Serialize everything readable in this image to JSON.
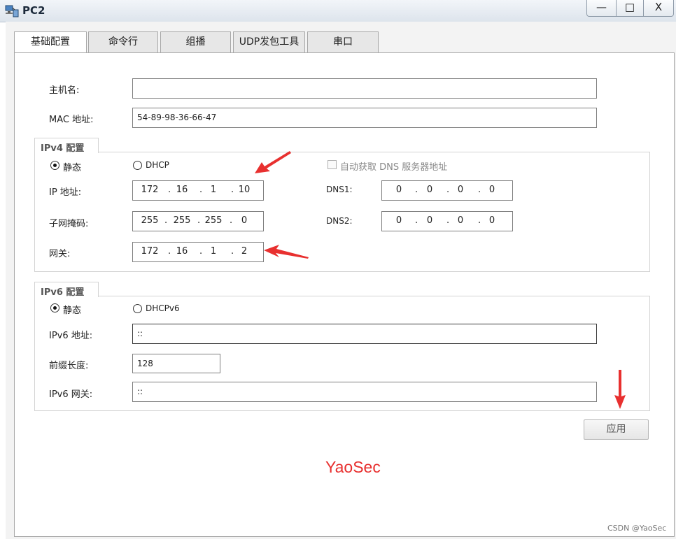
{
  "window": {
    "title": "PC2",
    "controls": {
      "minimize": "—",
      "maximize": "□",
      "close": "X"
    }
  },
  "tabs": [
    {
      "label": "基础配置",
      "active": true
    },
    {
      "label": "命令行",
      "active": false
    },
    {
      "label": "组播",
      "active": false
    },
    {
      "label": "UDP发包工具",
      "active": false
    },
    {
      "label": "串口",
      "active": false
    }
  ],
  "basic": {
    "hostname_label": "主机名:",
    "hostname_value": "",
    "mac_label": "MAC 地址:",
    "mac_value": "54-89-98-36-66-47"
  },
  "ipv4": {
    "group_title": "IPv4 配置",
    "static_label": "静态",
    "dhcp_label": "DHCP",
    "selected_mode": "static",
    "auto_dns_label": "自动获取 DNS 服务器地址",
    "auto_dns_checked": false,
    "ip_label": "IP 地址:",
    "ip": [
      "172",
      "16",
      "1",
      "10"
    ],
    "mask_label": "子网掩码:",
    "mask": [
      "255",
      "255",
      "255",
      "0"
    ],
    "gateway_label": "网关:",
    "gateway": [
      "172",
      "16",
      "1",
      "2"
    ],
    "dns1_label": "DNS1:",
    "dns1": [
      "0",
      "0",
      "0",
      "0"
    ],
    "dns2_label": "DNS2:",
    "dns2": [
      "0",
      "0",
      "0",
      "0"
    ]
  },
  "ipv6": {
    "group_title": "IPv6 配置",
    "static_label": "静态",
    "dhcp_label": "DHCPv6",
    "selected_mode": "static",
    "address_label": "IPv6 地址:",
    "address_value": "::",
    "prefix_label": "前缀长度:",
    "prefix_value": "128",
    "gateway_label": "IPv6 网关:",
    "gateway_value": "::"
  },
  "apply_label": "应用",
  "watermark": "YaoSec",
  "credit": "CSDN @YaoSec",
  "colors": {
    "annotation_arrow": "#e8302f",
    "title_text": "#1c2a3b"
  }
}
